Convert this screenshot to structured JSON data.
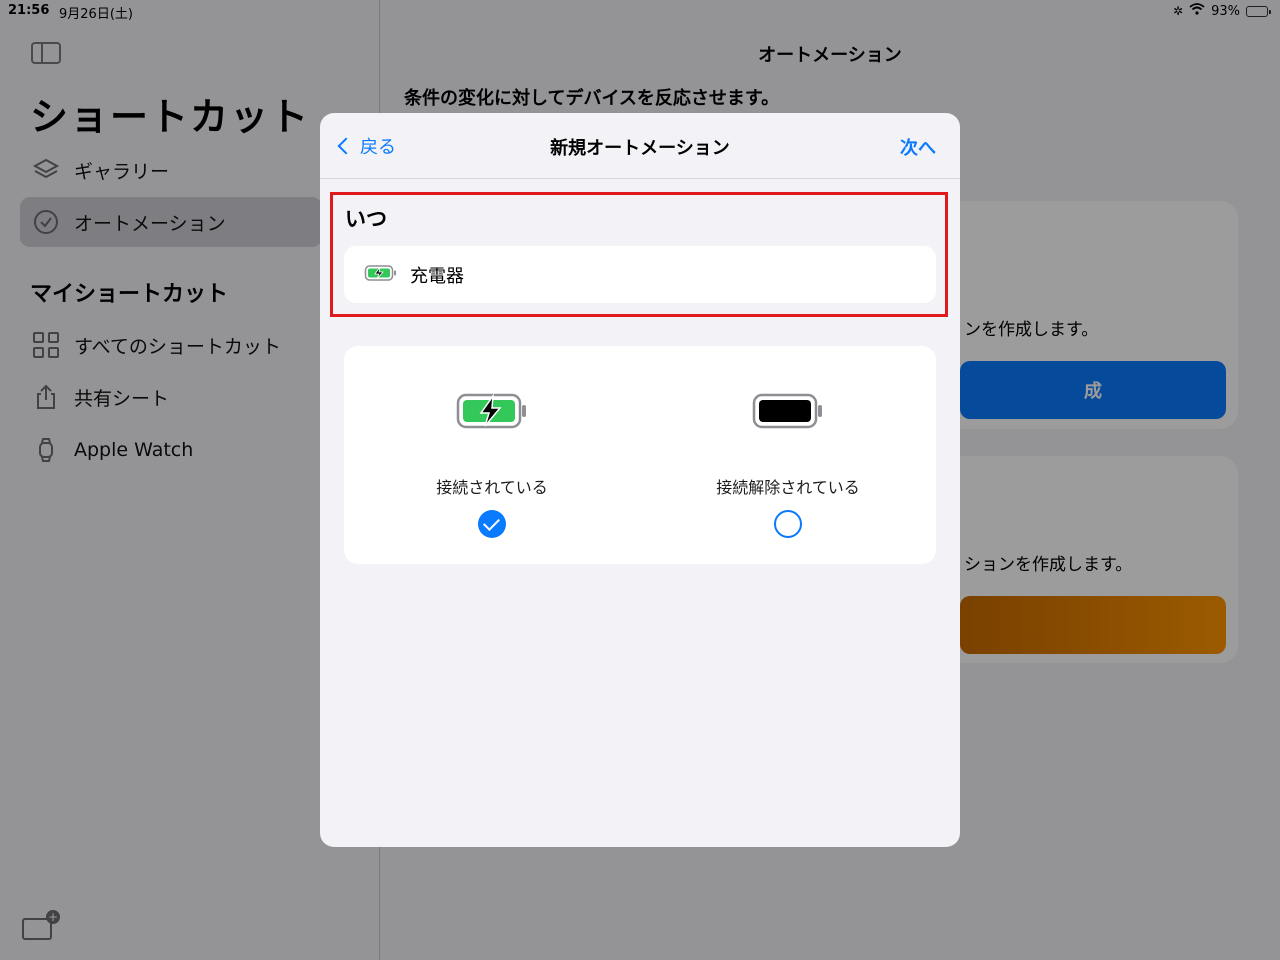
{
  "status_bar": {
    "time": "21:56",
    "date": "9月26日(土)",
    "battery_percent": "93%",
    "battery_level": 0.93
  },
  "sidebar": {
    "title": "ショートカット",
    "items": [
      {
        "label": "ギャラリー",
        "icon": "layers-icon",
        "selected": false
      },
      {
        "label": "オートメーション",
        "icon": "clock-check-icon",
        "selected": true
      }
    ],
    "section_title": "マイショートカット",
    "my_items": [
      {
        "label": "すべてのショートカット",
        "icon": "grid-icon"
      },
      {
        "label": "共有シート",
        "icon": "share-icon"
      },
      {
        "label": "Apple Watch",
        "icon": "watch-icon"
      }
    ]
  },
  "main": {
    "title": "オートメーション",
    "description": "条件の変化に対してデバイスを反応させます。",
    "card1_text": "ンを作成します。",
    "card1_button": "成",
    "card2_text": "ションを作成します。"
  },
  "modal": {
    "back_label": "戻る",
    "title": "新規オートメーション",
    "next_label": "次へ",
    "when_label": "いつ",
    "trigger_label": "充電器",
    "options": [
      {
        "label": "接続されている",
        "selected": true
      },
      {
        "label": "接続解除されている",
        "selected": false
      }
    ]
  },
  "colors": {
    "accent": "#0a7aff",
    "highlight": "#e0191c",
    "battery_green": "#34c759",
    "blue_button": "#0a7aff",
    "orange_button": "#ff9500"
  }
}
